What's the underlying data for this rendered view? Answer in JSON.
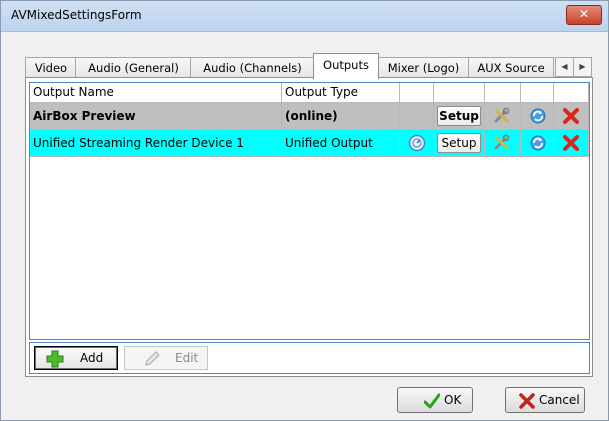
{
  "window": {
    "title": "AVMixedSettingsForm",
    "close_glyph": "✕"
  },
  "tabs": [
    {
      "label": "Video",
      "active": false
    },
    {
      "label": "Audio (General)",
      "active": false
    },
    {
      "label": "Audio (Channels)",
      "active": false
    },
    {
      "label": "Outputs",
      "active": true
    },
    {
      "label": "Mixer (Logo)",
      "active": false
    },
    {
      "label": "AUX Source",
      "active": false
    }
  ],
  "tab_scroll": {
    "left_glyph": "◀",
    "right_glyph": "▶"
  },
  "grid": {
    "columns": [
      "Output Name",
      "Output Type",
      "",
      "",
      "",
      "",
      ""
    ],
    "rows": [
      {
        "name": "AirBox Preview",
        "type": "(online)",
        "status_icon": "",
        "setup_label": "Setup",
        "highlight": "#bfbfbf",
        "icons": [
          "tools-icon",
          "refresh-icon",
          "delete-icon"
        ]
      },
      {
        "name": "Unified Streaming Render Device 1",
        "type": "Unified Output",
        "status_icon": "gauge-icon",
        "setup_label": "Setup",
        "highlight": "#00ffff",
        "icons": [
          "tools-icon",
          "refresh-icon",
          "delete-icon"
        ]
      }
    ]
  },
  "actions": {
    "add_label": "Add",
    "edit_label": "Edit"
  },
  "footer": {
    "ok_label": "OK",
    "cancel_label": "Cancel"
  },
  "colors": {
    "selected_row": "#00ffff",
    "preview_row": "#bfbfbf",
    "grid_border": "#4f86c6",
    "close_button": "#c7432a"
  }
}
